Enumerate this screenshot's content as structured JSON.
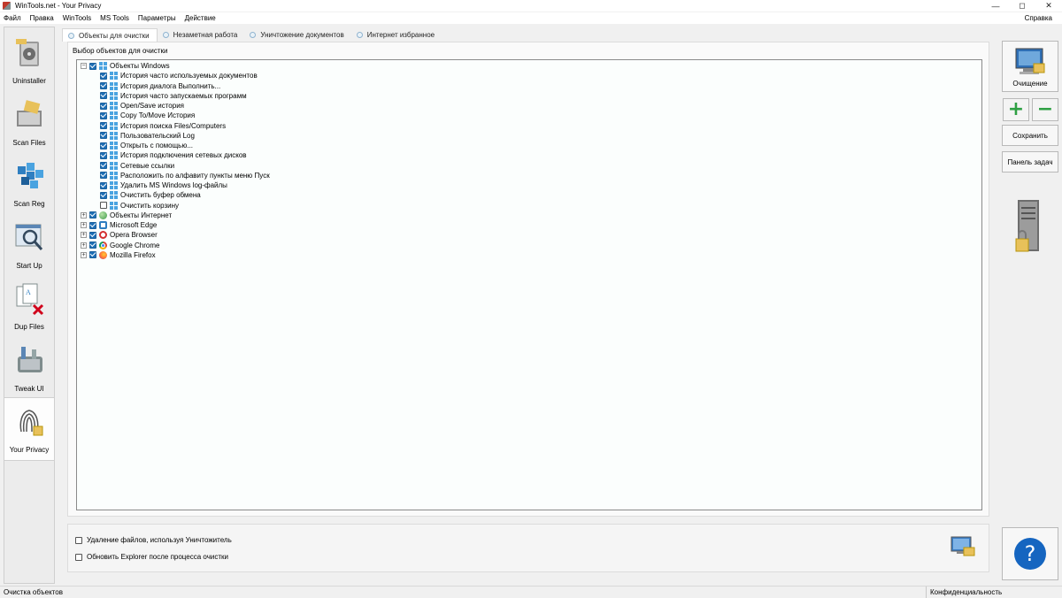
{
  "window": {
    "title": "WinTools.net - Your Privacy",
    "minimize": "—",
    "maximize": "◻",
    "close": "✕"
  },
  "menu": {
    "items": [
      "Файл",
      "Правка",
      "WinTools",
      "MS Tools",
      "Параметры",
      "Действие"
    ],
    "help": "Справка"
  },
  "sidebar": {
    "items": [
      {
        "label": "Uninstaller",
        "icon": "uninstaller-icon"
      },
      {
        "label": "Scan Files",
        "icon": "scan-files-icon"
      },
      {
        "label": "Scan Reg",
        "icon": "scan-reg-icon"
      },
      {
        "label": "Start Up",
        "icon": "startup-icon"
      },
      {
        "label": "Dup Files",
        "icon": "dup-files-icon"
      },
      {
        "label": "Tweak UI",
        "icon": "tweak-ui-icon"
      },
      {
        "label": "Your Privacy",
        "icon": "privacy-icon",
        "active": true
      }
    ]
  },
  "tabs": [
    {
      "label": "Объекты для очистки",
      "active": true
    },
    {
      "label": "Незаметная работа"
    },
    {
      "label": "Уничтожение документов"
    },
    {
      "label": "Интернет избранное"
    }
  ],
  "main": {
    "group_label": "Выбор объектов для очистки",
    "tree": [
      {
        "label": "Объекты Windows",
        "level": 0,
        "expander": "−",
        "checked": true,
        "icon": "ic-win"
      },
      {
        "label": "История часто используемых документов",
        "level": 1,
        "checked": true,
        "icon": "ic-win"
      },
      {
        "label": "История диалога Выполнить...",
        "level": 1,
        "checked": true,
        "icon": "ic-win"
      },
      {
        "label": "История часто запускаемых программ",
        "level": 1,
        "checked": true,
        "icon": "ic-win"
      },
      {
        "label": "Open/Save история",
        "level": 1,
        "checked": true,
        "icon": "ic-win"
      },
      {
        "label": "Copy To/Move История",
        "level": 1,
        "checked": true,
        "icon": "ic-win"
      },
      {
        "label": "История поиска Files/Computers",
        "level": 1,
        "checked": true,
        "icon": "ic-win"
      },
      {
        "label": "Пользовательский Log",
        "level": 1,
        "checked": true,
        "icon": "ic-win"
      },
      {
        "label": "Открыть с помощью...",
        "level": 1,
        "checked": true,
        "icon": "ic-win"
      },
      {
        "label": "История подключения сетевых дисков",
        "level": 1,
        "checked": true,
        "icon": "ic-win"
      },
      {
        "label": "Сетевые ссылки",
        "level": 1,
        "checked": true,
        "icon": "ic-win"
      },
      {
        "label": "Расположить по алфавиту пункты меню Пуск",
        "level": 1,
        "checked": true,
        "icon": "ic-win"
      },
      {
        "label": "Удалить MS Windows log-файлы",
        "level": 1,
        "checked": true,
        "icon": "ic-win"
      },
      {
        "label": "Очистить буфер обмена",
        "level": 1,
        "checked": true,
        "icon": "ic-win"
      },
      {
        "label": "Очистить корзину",
        "level": 1,
        "checked": false,
        "icon": "ic-win"
      },
      {
        "label": "Объекты Интернет",
        "level": 0,
        "expander": "+",
        "checked": true,
        "icon": "ic-globe"
      },
      {
        "label": "Microsoft Edge",
        "level": 0,
        "expander": "+",
        "checked": true,
        "icon": "ic-edge"
      },
      {
        "label": "Opera Browser",
        "level": 0,
        "expander": "+",
        "checked": true,
        "icon": "ic-opera"
      },
      {
        "label": "Google Chrome",
        "level": 0,
        "expander": "+",
        "checked": true,
        "icon": "ic-chrome"
      },
      {
        "label": "Mozilla Firefox",
        "level": 0,
        "expander": "+",
        "checked": true,
        "icon": "ic-firefox"
      }
    ]
  },
  "options": [
    {
      "label": "Удаление файлов, используя Уничтожитель",
      "checked": false
    },
    {
      "label": "Обновить Explorer после процесса очистки",
      "checked": false
    }
  ],
  "actions": {
    "clean_label": "Очищение",
    "add": "+",
    "remove": "−",
    "save_label": "Сохранить",
    "taskbar_label": "Панель задач",
    "help": "?"
  },
  "status": {
    "left": "Очистка объектов",
    "right": "Конфиденциальность"
  },
  "colors": {
    "accent": "#1f6fb5",
    "help_button": "#1565c0",
    "add_green": "#2ea043"
  }
}
